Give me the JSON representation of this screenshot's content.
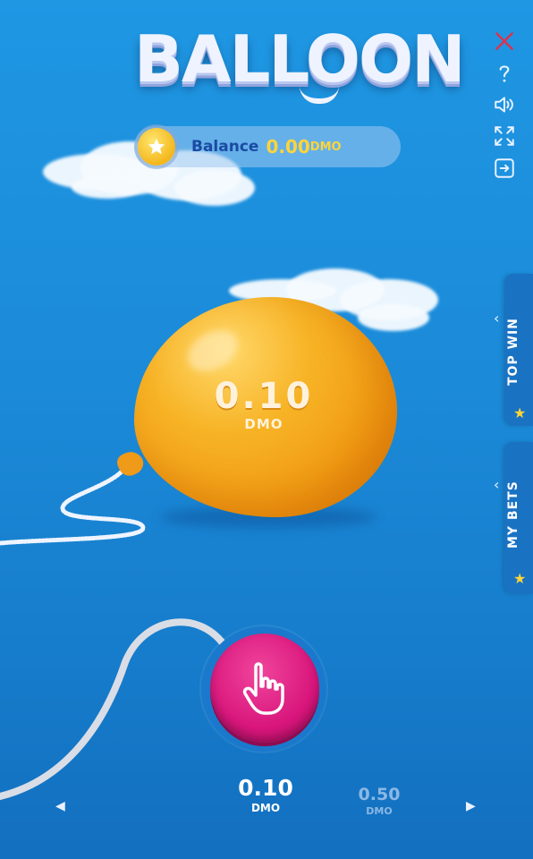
{
  "game": {
    "title": "BALLOON"
  },
  "controls": {
    "close_icon": "close-icon",
    "help_icon": "help-icon",
    "sound_icon": "sound-icon",
    "fullscreen_icon": "fullscreen-icon",
    "exit_icon": "exit-icon"
  },
  "balance": {
    "label": "Balance",
    "value": "0.00",
    "unit": "DMO"
  },
  "balloon": {
    "value": "0.10",
    "unit": "DMO",
    "color": "#f5a81c"
  },
  "side_tabs": [
    {
      "label": "TOP WIN"
    },
    {
      "label": "MY BETS"
    }
  ],
  "pump_button": {
    "icon": "hand-pointer-icon",
    "color": "#d9167c"
  },
  "bet_selector": {
    "selected_value": "0.10",
    "selected_unit": "DMO",
    "next_value": "0.50",
    "next_unit": "DMO",
    "prev_icon": "arrow-left-icon",
    "next_icon": "arrow-right-icon"
  }
}
